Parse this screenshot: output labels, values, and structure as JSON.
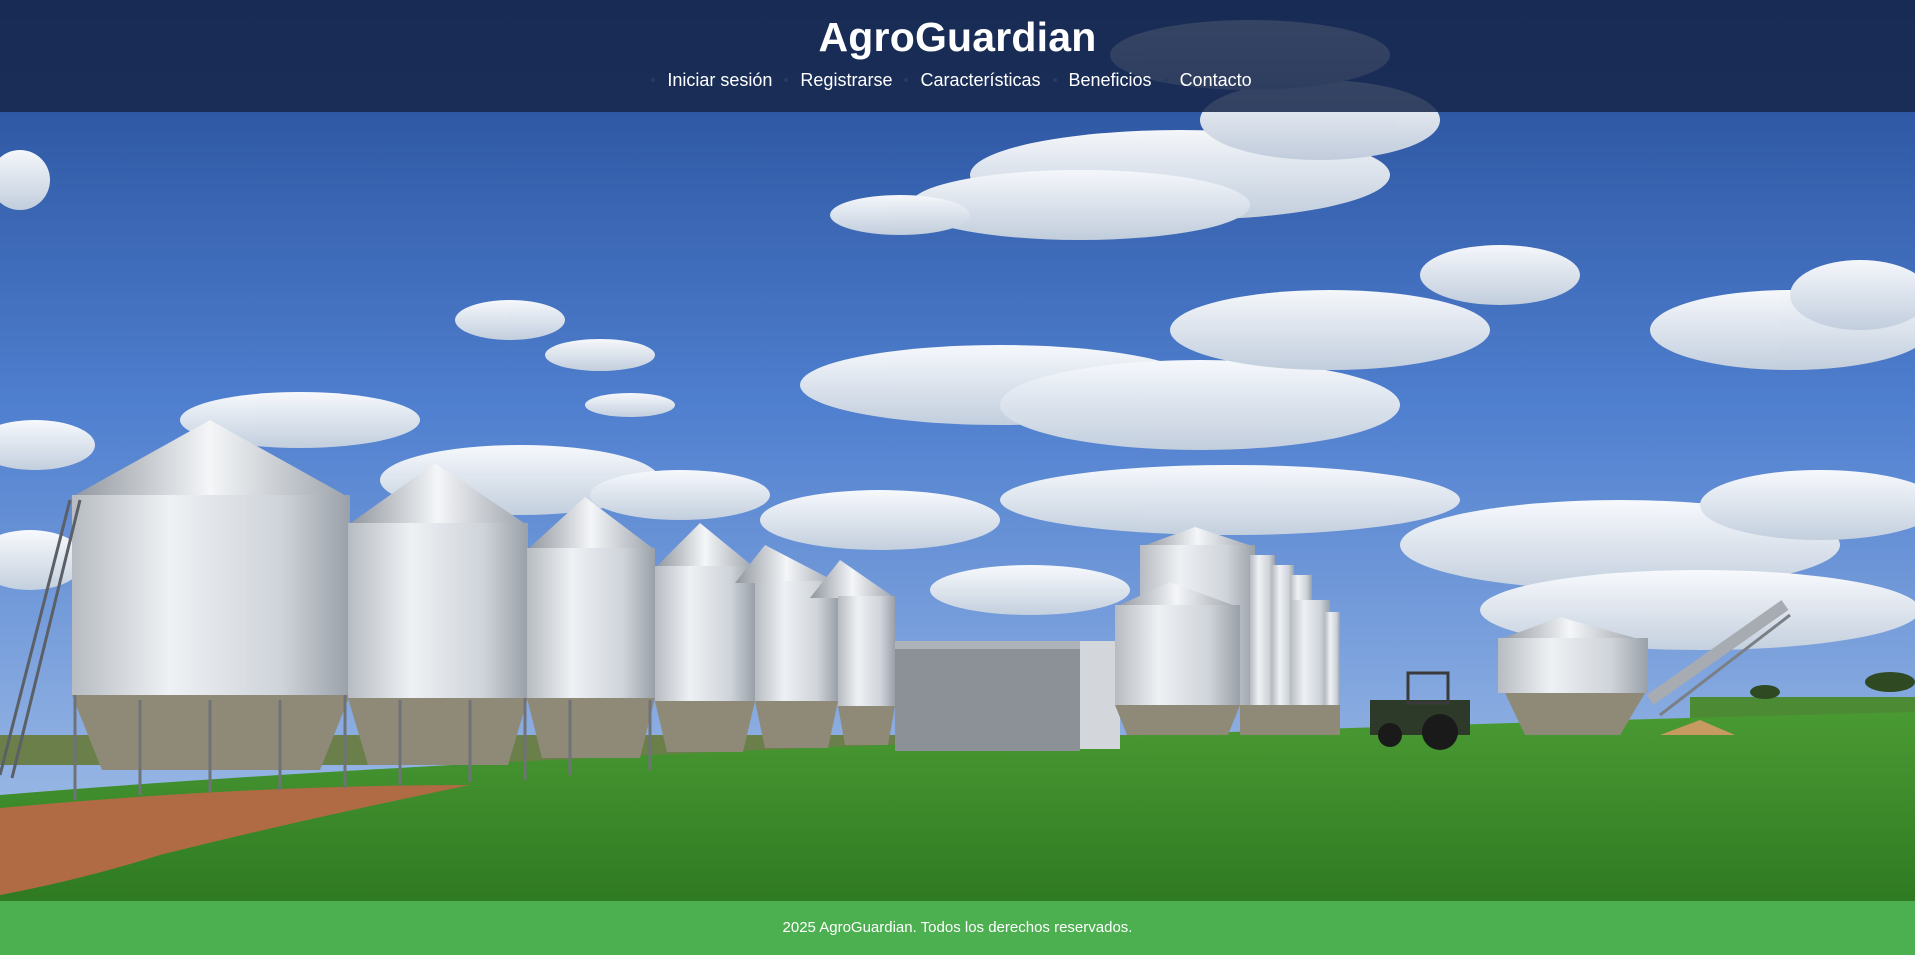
{
  "site": {
    "title": "AgroGuardian"
  },
  "nav": {
    "items": [
      {
        "label": "Iniciar sesión"
      },
      {
        "label": "Registrarse"
      },
      {
        "label": "Características"
      },
      {
        "label": "Beneficios"
      },
      {
        "label": "Contacto"
      }
    ]
  },
  "hero": {
    "image_subject": "grain-silos-field-photo"
  },
  "footer": {
    "text": "2025 AgroGuardian. Todos los derechos reservados."
  },
  "colors": {
    "header_bg": "#16264a",
    "footer_bg": "#4caf50",
    "text": "#ffffff",
    "sky_top": "#2f5aa8",
    "sky_bottom": "#8fb6e8",
    "field": "#3f8f2c"
  }
}
